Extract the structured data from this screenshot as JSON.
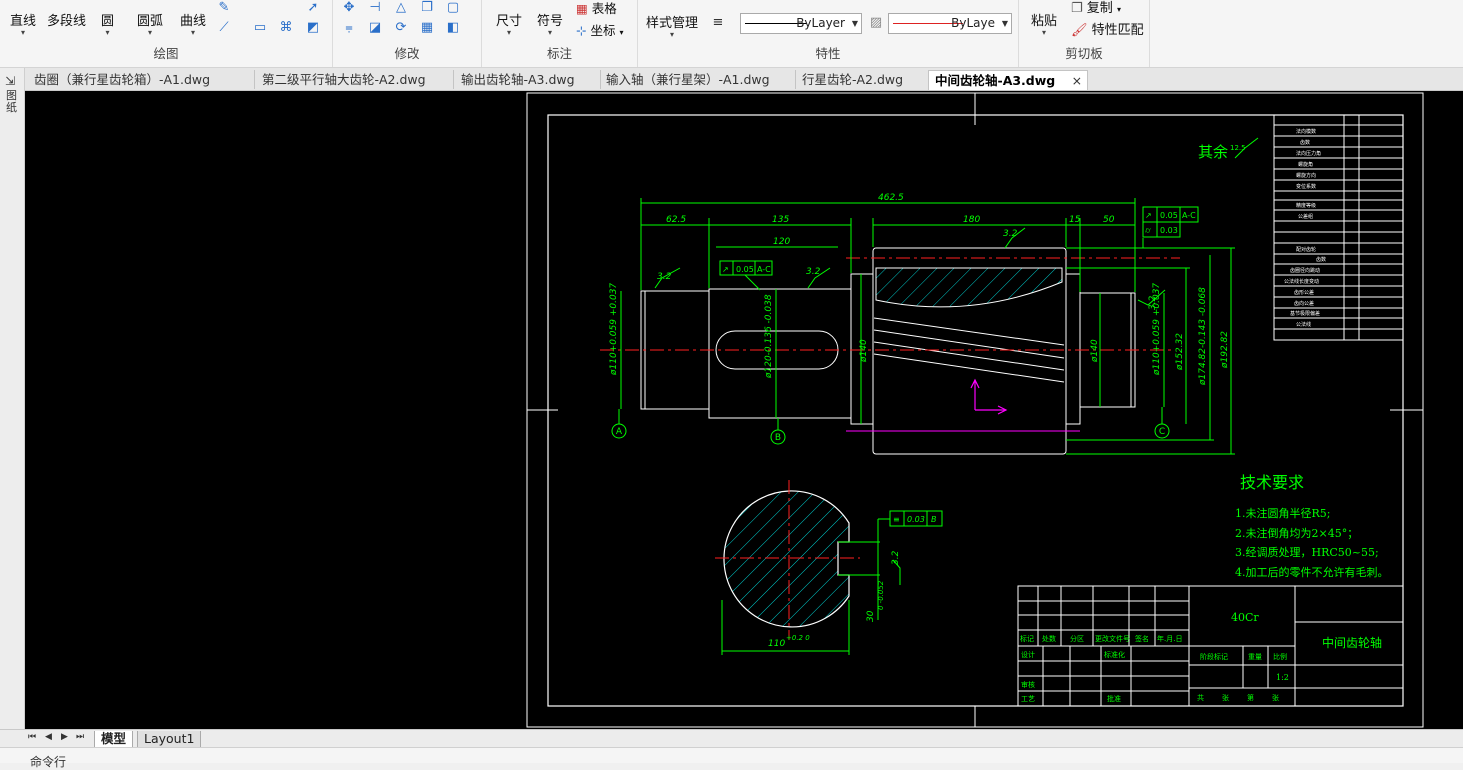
{
  "ribbon": {
    "draw": {
      "label": "绘图",
      "buttons": [
        "直线",
        "多段线",
        "圆",
        "圆弧",
        "曲线"
      ]
    },
    "modify": {
      "label": "修改"
    },
    "annotate": {
      "label": "标注",
      "buttons": [
        "尺寸",
        "符号"
      ],
      "table_label": "表格",
      "coord_label": "坐标"
    },
    "properties": {
      "label": "特性",
      "style_mgr": "样式管理",
      "linetype_value": "ByLayer",
      "lineweight_value": "ByLaye"
    },
    "clipboard": {
      "label": "剪切板",
      "paste": "粘贴",
      "copy": "复制",
      "match": "特性匹配"
    }
  },
  "tabs": [
    {
      "label": "齿圈（兼行星齿轮箱）-A1.dwg"
    },
    {
      "label": "第二级平行轴大齿轮-A2.dwg"
    },
    {
      "label": "输出齿轮轴-A3.dwg"
    },
    {
      "label": "输入轴（兼行星架）-A1.dwg"
    },
    {
      "label": "行星齿轮-A2.dwg"
    },
    {
      "label": "中间齿轮轴-A3.dwg"
    }
  ],
  "tab_close": "×",
  "left_strip_text": "图纸",
  "layout_tabs": [
    "模型",
    "Layout1"
  ],
  "command_prompt": "命令行",
  "drawing": {
    "roughness_note": "其余",
    "roughness_value": "12.5",
    "roughness_marks": [
      "3.2",
      "3.2",
      "3.2",
      "3.2",
      "3.2"
    ],
    "dims": {
      "total": "462.5",
      "d1": "62.5",
      "d2": "135",
      "d3": "120",
      "d4": "180",
      "d5": "15",
      "d6": "50",
      "dia_left": "ø110+0.059 +0.037",
      "dia_key": "ø120-0.136 -0.038",
      "dia_140a": "ø140",
      "dia_140b": "ø140",
      "dia_right": "ø110+0.059 +0.037",
      "dia_15232": "ø152.32",
      "dia_17482": "ø174.82-0.143 -0.068",
      "dia_19282": "ø192.82",
      "sec_width": "110",
      "sec_width_tol": "+0.2 0",
      "sec_depth": "30",
      "sec_depth_tol": "0 -0.052"
    },
    "tol_frames": {
      "top_left": [
        "↗",
        "0.05",
        "A-C"
      ],
      "top_right_1": [
        "↗",
        "0.05",
        "A-C"
      ],
      "top_right_2": [
        "⌭",
        "0.03"
      ],
      "section": [
        "≡",
        "0.03",
        "B"
      ]
    },
    "datums": [
      "A",
      "B",
      "C"
    ],
    "tech_title": "技术要求",
    "tech_items": [
      "1.未注圆角半径R5;",
      "2.未注倒角均为2×45°；",
      "3.经调质处理，HRC50~55;",
      "4.加工后的零件不允许有毛刺。"
    ],
    "title_block": {
      "material": "40Cr",
      "part_name": "中间齿轮轴",
      "scale": "1:2",
      "row_labels": [
        "标记",
        "处数",
        "分区",
        "更改文件号",
        "签名",
        "年.月.日"
      ],
      "left_labels": [
        "设计",
        "标准化",
        "审核",
        "工艺",
        "批准"
      ],
      "right_labels": [
        "阶段标记",
        "重量",
        "比例"
      ],
      "sheet_labels": [
        "共",
        "张",
        "第",
        "张"
      ]
    },
    "param_table_rows": [
      "法向模数",
      "齿数",
      "法向压力角",
      "螺旋角",
      "螺旋方向",
      "变位系数",
      "精度等级",
      "公差组",
      "配对齿轮",
      "齿数",
      "齿圈径向跳动",
      "公法线长度变动",
      "齿形公差",
      "齿向公差",
      "基节极限偏差",
      "公法线"
    ]
  },
  "colors": {
    "outline": "#ffffff",
    "dimension": "#00ff00",
    "centerline": "#ff2020",
    "hatch": "#00c8c8",
    "ucs": "#ff00ff"
  }
}
